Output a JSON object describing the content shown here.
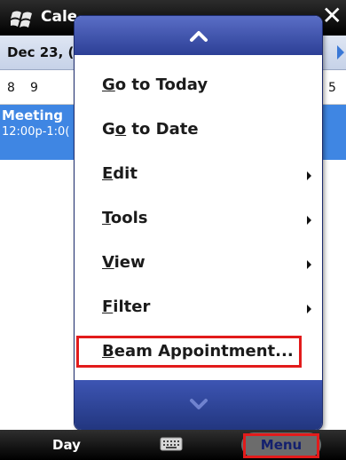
{
  "titlebar": {
    "title": "Cale",
    "start_icon": "windows-flag-icon",
    "close_icon": "close-icon",
    "close_label": "✕"
  },
  "date_header": {
    "date": "Dec 23, (",
    "next_icon": "triangle-right-icon"
  },
  "hours": {
    "first": "8",
    "second": "9",
    "last": "5"
  },
  "appointment": {
    "title": "Meeting",
    "time": "12:00p-1:0("
  },
  "menu": {
    "items": [
      {
        "pre": "",
        "key": "G",
        "post": "o to Today",
        "submenu": false
      },
      {
        "pre": "G",
        "key": "o",
        "post": " to Date",
        "submenu": false
      },
      {
        "pre": "",
        "key": "E",
        "post": "dit",
        "submenu": true
      },
      {
        "pre": "",
        "key": "T",
        "post": "ools",
        "submenu": true
      },
      {
        "pre": "",
        "key": "V",
        "post": "iew",
        "submenu": true
      },
      {
        "pre": "",
        "key": "F",
        "post": "ilter",
        "submenu": true
      },
      {
        "pre": "",
        "key": "B",
        "post": "eam Appointment...",
        "submenu": false
      }
    ],
    "scroll_up_icon": "chevron-up-icon",
    "scroll_down_icon": "chevron-down-icon"
  },
  "softkeys": {
    "left": "Day",
    "keyboard_icon": "keyboard-icon",
    "right": "Menu"
  },
  "colors": {
    "appointment": "#3f86e3",
    "menu_header": "#2c3f96",
    "highlight": "#e21b1b",
    "menu_key_text": "#14206e"
  }
}
